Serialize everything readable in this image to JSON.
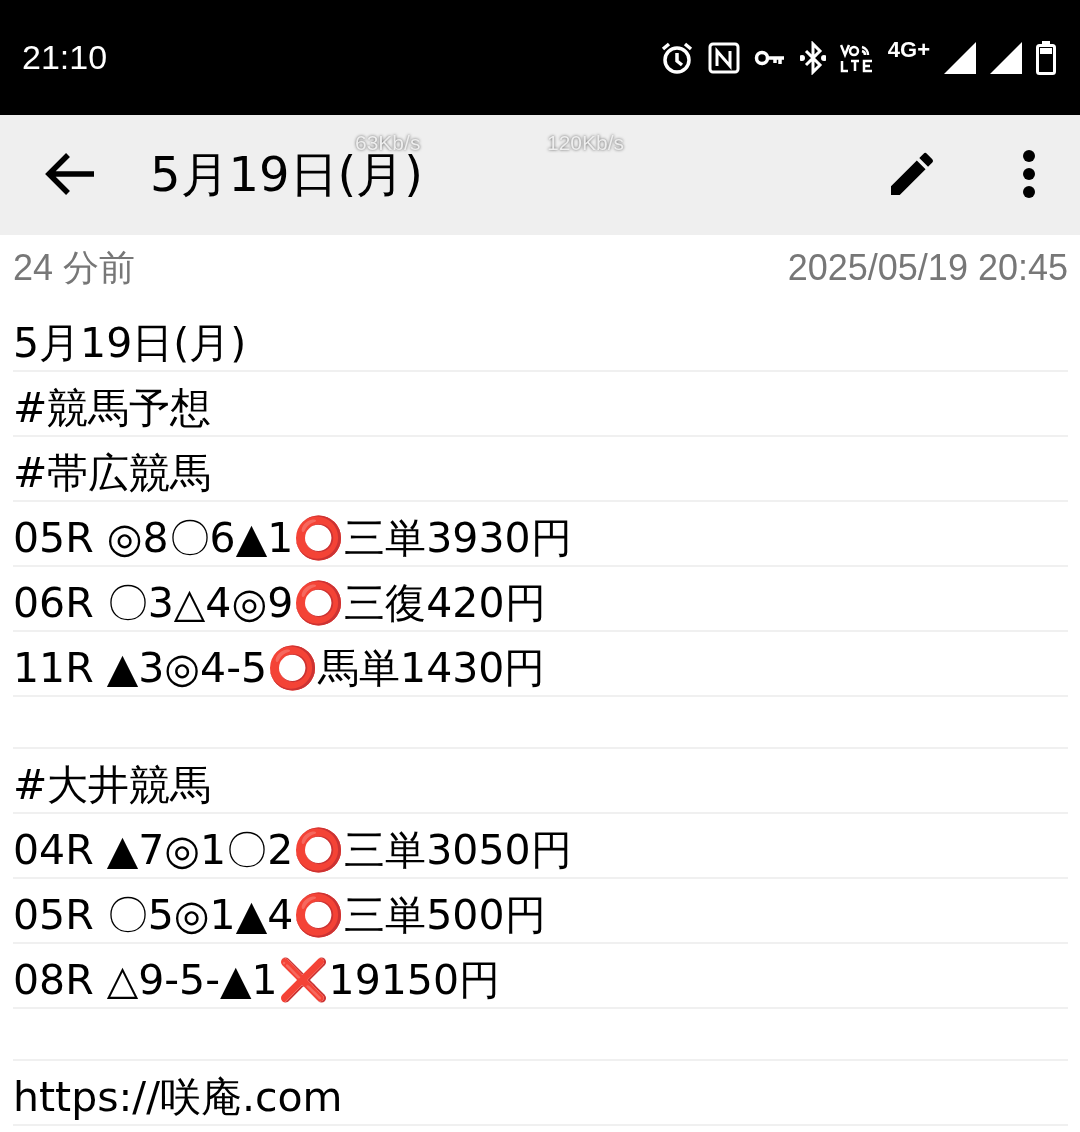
{
  "status_bar": {
    "time": "21:10",
    "network_type": "4G+"
  },
  "speed_overlay": [
    "63Kb/s",
    "120Kb/s"
  ],
  "app_bar": {
    "title": "5月19日(月)"
  },
  "meta": {
    "relative_time": "24 分前",
    "timestamp": "2025/05/19 20:45"
  },
  "lines": [
    {
      "kind": "text",
      "text": "5月19日(月)"
    },
    {
      "kind": "text",
      "text": "#競馬予想"
    },
    {
      "kind": "text",
      "text": "#帯広競馬"
    },
    {
      "kind": "text",
      "text": "05R ◎8〇6▲1⭕三単3930円"
    },
    {
      "kind": "text",
      "text": "06R 〇3△4◎9⭕三復420円"
    },
    {
      "kind": "text",
      "text": "11R ▲3◎4-5⭕馬単1430円"
    },
    {
      "kind": "blank"
    },
    {
      "kind": "text",
      "text": "#大井競馬"
    },
    {
      "kind": "text",
      "text": "04R ▲7◎1〇2⭕三単3050円"
    },
    {
      "kind": "text",
      "text": "05R 〇5◎1▲4⭕三単500円"
    },
    {
      "kind": "text",
      "text": "08R △9-5-▲1❌19150円"
    },
    {
      "kind": "blank"
    },
    {
      "kind": "text",
      "text": "https://咲庵.com"
    }
  ]
}
